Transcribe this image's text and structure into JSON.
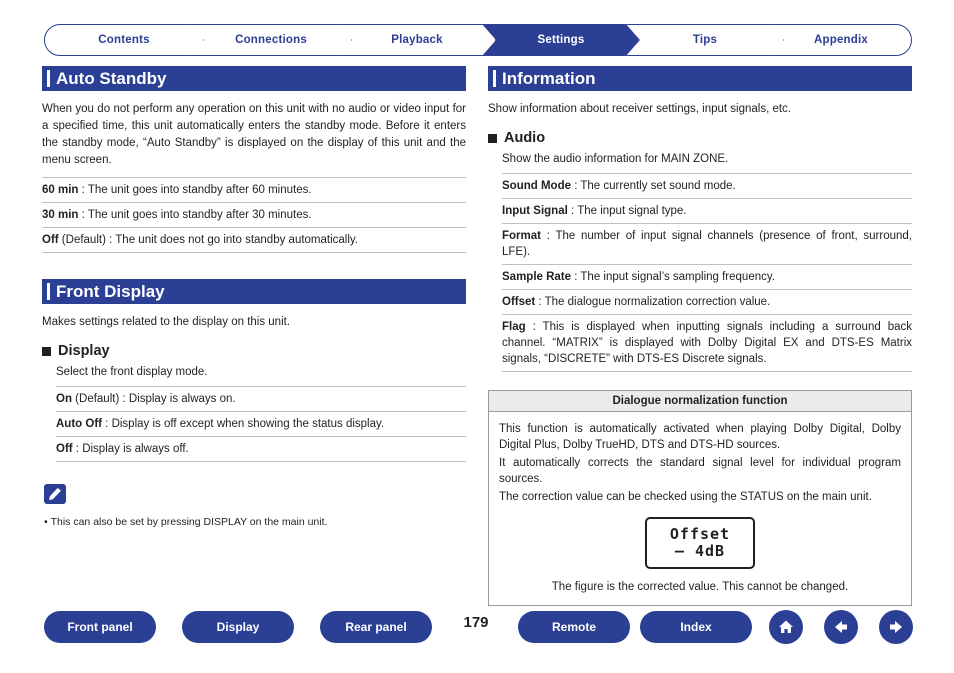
{
  "tabs": [
    {
      "label": "Contents",
      "active": false
    },
    {
      "label": "Connections",
      "active": false
    },
    {
      "label": "Playback",
      "active": false
    },
    {
      "label": "Settings",
      "active": true
    },
    {
      "label": "Tips",
      "active": false
    },
    {
      "label": "Appendix",
      "active": false
    }
  ],
  "left": {
    "section1": {
      "title": "Auto Standby",
      "intro": "When you do not perform any operation on this unit with no audio or video input for a specified time, this unit automatically enters the standby mode. Before it enters the standby mode, “Auto Standby” is displayed on the display of this unit and the menu screen.",
      "options": [
        {
          "term": "60 min",
          "default": "",
          "desc": " : The unit goes into standby after 60 minutes."
        },
        {
          "term": "30 min",
          "default": "",
          "desc": " : The unit goes into standby after 30 minutes."
        },
        {
          "term": "Off",
          "default": " (Default)",
          "desc": " : The unit does not go into standby automatically."
        }
      ]
    },
    "section2": {
      "title": "Front Display",
      "intro": "Makes settings related to the display on this unit.",
      "subhead": "Display",
      "sub_intro": "Select the front display mode.",
      "options": [
        {
          "term": "On",
          "default": " (Default)",
          "desc": " : Display is always on."
        },
        {
          "term": "Auto Off",
          "default": "",
          "desc": " : Display is off except when showing the status display."
        },
        {
          "term": "Off",
          "default": "",
          "desc": " : Display is always off."
        }
      ],
      "note": "This can also be set by pressing DISPLAY on the main unit."
    }
  },
  "right": {
    "section1": {
      "title": "Information",
      "intro": "Show information about receiver settings, input signals, etc.",
      "subhead": "Audio",
      "sub_intro": "Show the audio information for MAIN ZONE.",
      "options": [
        {
          "term": "Sound Mode",
          "default": "",
          "desc": " : The currently set sound mode."
        },
        {
          "term": "Input Signal",
          "default": "",
          "desc": " : The input signal type."
        },
        {
          "term": "Format",
          "default": "",
          "desc": " : The number of input signal channels (presence of front, surround, LFE)."
        },
        {
          "term": "Sample Rate",
          "default": "",
          "desc": " : The input signal’s sampling frequency."
        },
        {
          "term": "Offset",
          "default": "",
          "desc": " : The dialogue normalization correction value."
        },
        {
          "term": "Flag",
          "default": "",
          "desc": " : This is displayed when inputting signals including a surround back channel. “MATRIX” is displayed with Dolby Digital EX and DTS-ES Matrix signals, “DISCRETE” with DTS-ES Discrete signals."
        }
      ]
    },
    "dialogue_box": {
      "title": "Dialogue normalization function",
      "paragraphs": [
        "This function is automatically activated when playing Dolby Digital, Dolby Digital Plus, Dolby TrueHD, DTS and DTS-HD sources.",
        "It automatically corrects the standard signal level for individual program sources.",
        "The correction value can be checked using the STATUS on the main unit."
      ],
      "lcd_line1": "Offset",
      "lcd_line2": "– 4dB",
      "caption": "The figure is the corrected value. This cannot be changed."
    }
  },
  "footer": {
    "buttons": [
      {
        "label": "Front panel"
      },
      {
        "label": "Display"
      },
      {
        "label": "Rear panel"
      },
      {
        "label": "Remote"
      },
      {
        "label": "Index"
      }
    ],
    "page_number": "179",
    "icons": [
      {
        "name": "home-icon"
      },
      {
        "name": "back-arrow-icon"
      },
      {
        "name": "forward-arrow-icon"
      }
    ]
  }
}
